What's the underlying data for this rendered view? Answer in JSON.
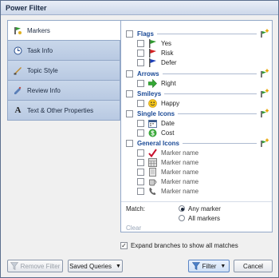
{
  "window": {
    "title": "Power Filter"
  },
  "tabs": [
    {
      "label": "Markers",
      "icon": "markers-icon"
    },
    {
      "label": "Task Info",
      "icon": "clock-icon"
    },
    {
      "label": "Topic Style",
      "icon": "style-icon"
    },
    {
      "label": "Review Info",
      "icon": "review-icon"
    },
    {
      "label": "Text & Other Properties",
      "icon": "text-icon"
    }
  ],
  "groups": {
    "flags": {
      "label": "Flags",
      "items": [
        "Yes",
        "Risk",
        "Defer"
      ],
      "colors": [
        "#2f9a2f",
        "#d42020",
        "#1d3fb8"
      ]
    },
    "arrows": {
      "label": "Arrows",
      "items": [
        "Right"
      ]
    },
    "smileys": {
      "label": "Smileys",
      "items": [
        "Happy"
      ]
    },
    "single_icons": {
      "label": "Single Icons",
      "items": [
        "Date",
        "Cost"
      ]
    },
    "general_icons": {
      "label": "General Icons",
      "items": [
        "Marker name",
        "Marker name",
        "Marker name",
        "Marker name",
        "Marker name"
      ]
    }
  },
  "match": {
    "label": "Match:",
    "options": [
      "Any marker",
      "All markers"
    ],
    "selected": "Any marker"
  },
  "clear_label": "Clear",
  "expand_branches": {
    "label": "Expand branches to show all matches",
    "checked": true
  },
  "buttons": {
    "remove_filter": "Remove Filter",
    "saved_queries": "Saved Queries",
    "filter": "Filter",
    "cancel": "Cancel"
  },
  "colors": {
    "accent": "#1b4a96",
    "tab_bg": "#c2d2e8"
  }
}
